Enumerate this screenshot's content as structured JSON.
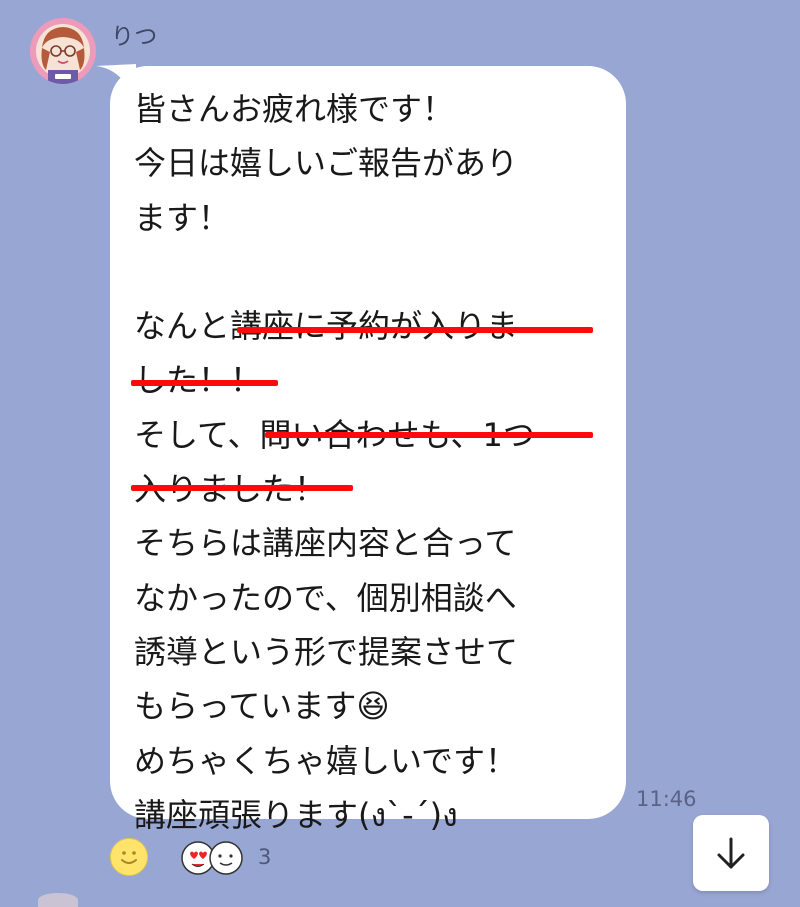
{
  "chat": {
    "sender_name": "りつ",
    "message": "皆さんお疲れ様です！\n今日は嬉しいご報告があり\nます！\n\nなんと講座に予約が入りま\nした！！\nそして、問い合わせも、1つ\n入りました！\nそちらは講座内容と合って\nなかったので、個別相談へ\n誘導という形で提案させて\nもらっています😆\nめちゃくちゃ嬉しいです！\n講座頑張ります(ง`̀-´́)ง",
    "timestamp": "11:46",
    "reaction_count": "3"
  },
  "icons": {
    "avatar": "avatar-icon",
    "add_reaction": "smiley-face-icon",
    "reaction_love": "heart-eyes-icon",
    "reaction_smile": "smile-face-icon",
    "scroll_down": "arrow-down-icon"
  },
  "colors": {
    "background": "#98a6d3",
    "bubble": "#ffffff",
    "highlight_underline": "#ff0a0a",
    "text": "#191919"
  }
}
